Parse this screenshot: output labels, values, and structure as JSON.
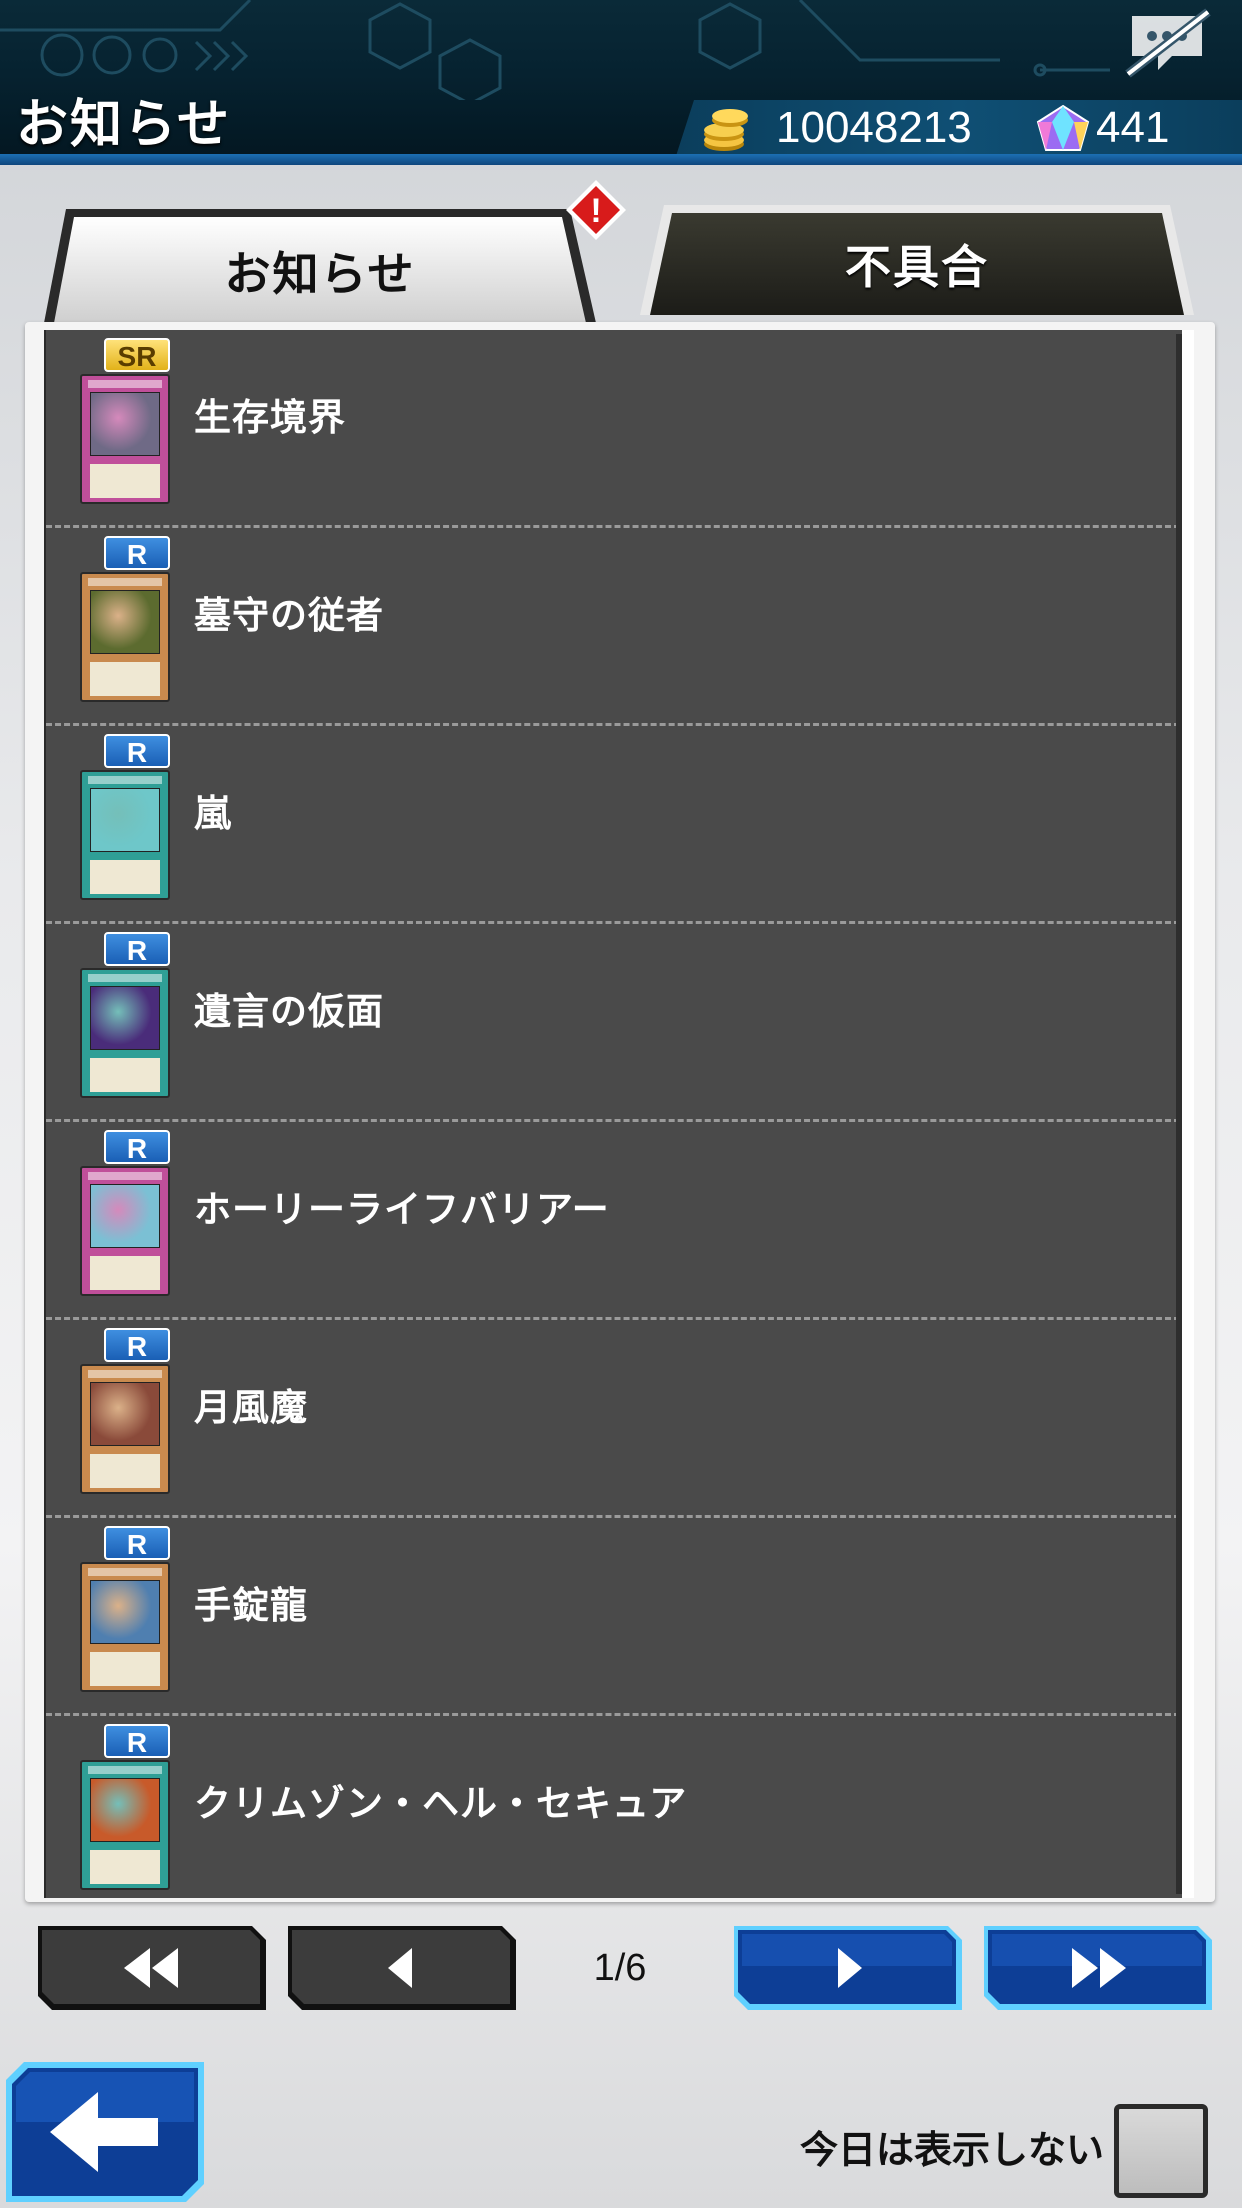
{
  "header": {
    "title": "お知らせ",
    "coins": "10048213",
    "gems": "441",
    "coin_icon": "gold-coins-icon",
    "gem_icon": "gem-icon",
    "chat_icon": "chat-disabled-icon"
  },
  "tabs": [
    {
      "label": "お知らせ",
      "active": true,
      "alert": "!"
    },
    {
      "label": "不具合",
      "active": false
    }
  ],
  "items": [
    {
      "rarity": "SR",
      "name": "生存境界",
      "card_color": "#c04f9a",
      "art_color": "#6f6a86"
    },
    {
      "rarity": "R",
      "name": "墓守の従者",
      "card_color": "#c98a4e",
      "art_color": "#5c6b2f"
    },
    {
      "rarity": "R",
      "name": "嵐",
      "card_color": "#2f9f96",
      "art_color": "#6ec7c9"
    },
    {
      "rarity": "R",
      "name": "遺言の仮面",
      "card_color": "#2f9f96",
      "art_color": "#4a2c7a"
    },
    {
      "rarity": "R",
      "name": "ホーリーライフバリアー",
      "card_color": "#c04f9a",
      "art_color": "#7bc0d4"
    },
    {
      "rarity": "R",
      "name": "月風魔",
      "card_color": "#c98a4e",
      "art_color": "#8a4a3a"
    },
    {
      "rarity": "R",
      "name": "手錠龍",
      "card_color": "#c98a4e",
      "art_color": "#4f7fb0"
    },
    {
      "rarity": "R",
      "name": "クリムゾン・ヘル・セキュア",
      "card_color": "#2f9f96",
      "art_color": "#c85a2a"
    }
  ],
  "pagination": {
    "page": "1/6",
    "first_icon": "double-chevron-left-icon",
    "prev_icon": "chevron-left-icon",
    "next_icon": "chevron-right-icon",
    "last_icon": "double-chevron-right-icon"
  },
  "footer": {
    "back_icon": "arrow-left-icon",
    "dont_show_label": "今日は表示しない",
    "dont_show_checked": false
  },
  "colors": {
    "header_bg": "#062230",
    "accent_blue": "#1c6fb4",
    "panel_bg": "#4a4a4a",
    "alert_red": "#d81b1b"
  }
}
